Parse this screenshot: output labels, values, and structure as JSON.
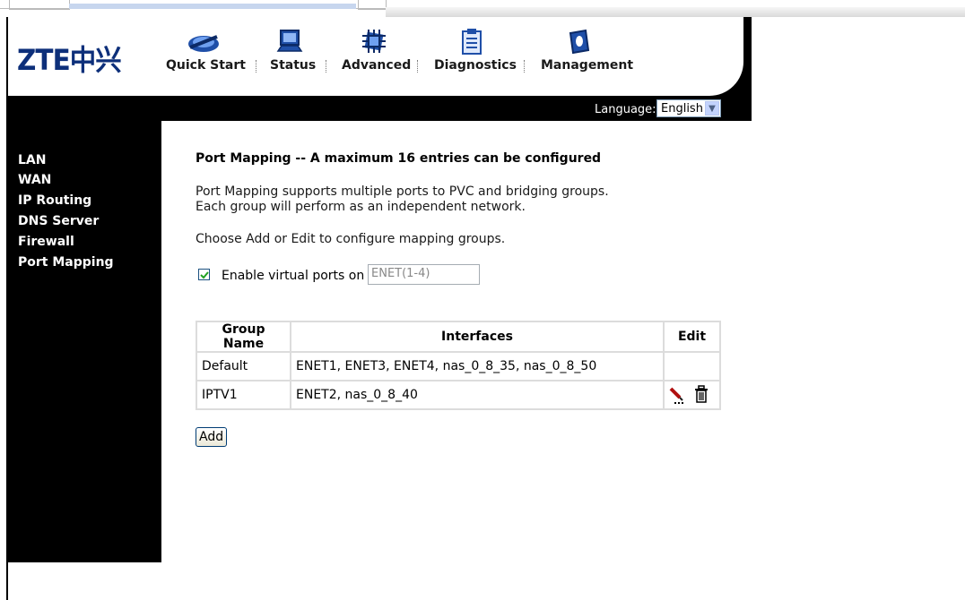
{
  "logo": {
    "text": "ZTE中兴"
  },
  "nav": [
    {
      "label": "Quick Start",
      "icon": "quick-start-icon"
    },
    {
      "label": "Status",
      "icon": "status-icon"
    },
    {
      "label": "Advanced",
      "icon": "advanced-icon"
    },
    {
      "label": "Diagnostics",
      "icon": "diagnostics-icon"
    },
    {
      "label": "Management",
      "icon": "management-icon"
    }
  ],
  "language": {
    "label": "Language:",
    "selected": "English"
  },
  "sidebar": {
    "items": [
      "LAN",
      "WAN",
      "IP Routing",
      "DNS Server",
      "Firewall",
      "Port Mapping"
    ]
  },
  "main": {
    "title": "Port Mapping -- A maximum 16 entries can be configured",
    "desc_line1": "Port Mapping supports multiple ports to PVC and bridging groups.",
    "desc_line2": "Each group will perform as an independent network.",
    "instruction": "Choose Add or Edit to configure mapping groups.",
    "virtual_ports": {
      "label": "Enable virtual ports on",
      "value": "ENET(1-4)",
      "checked": true
    },
    "table": {
      "headers": [
        "Group Name",
        "Interfaces",
        "Edit"
      ],
      "rows": [
        {
          "group": "Default",
          "interfaces": "ENET1, ENET3, ENET4, nas_0_8_35, nas_0_8_50"
        },
        {
          "group": "IPTV1",
          "interfaces": "ENET2, nas_0_8_40"
        }
      ]
    },
    "add_label": "Add"
  },
  "colors": {
    "brand": "#0d2f7a",
    "header_bg": "#000000",
    "nav_icon": "#1f4fa8"
  }
}
